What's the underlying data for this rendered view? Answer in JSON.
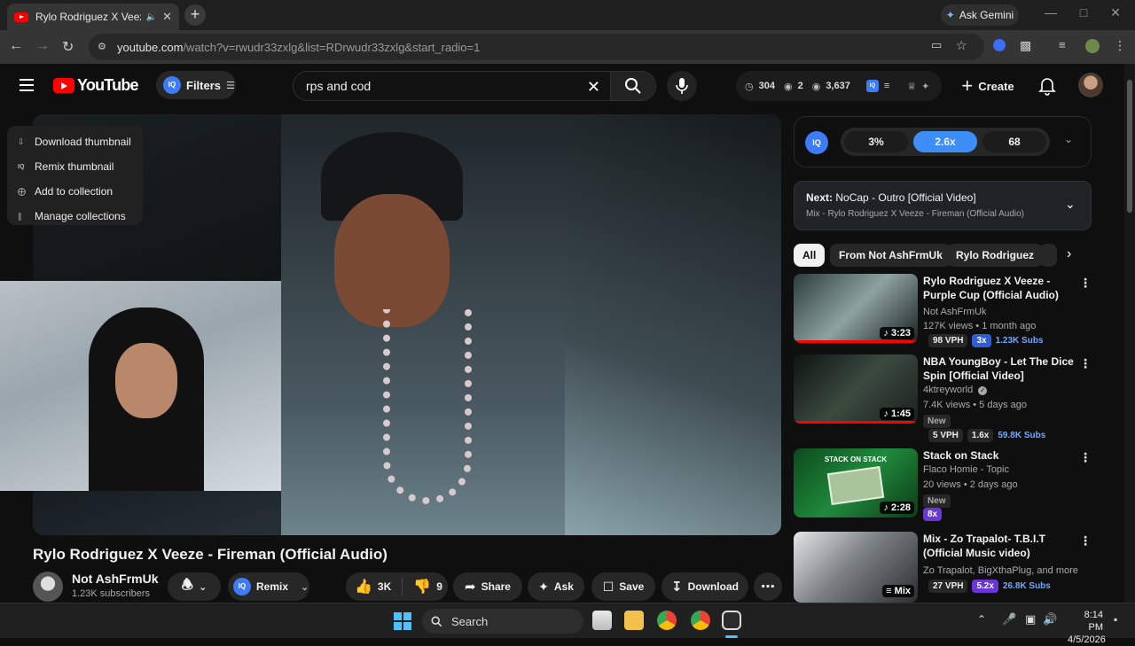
{
  "browser": {
    "tab_title": "Rylo Rodriguez X Veeze - Fi",
    "ask_gemini": "Ask Gemini",
    "url_host": "youtube.com",
    "url_path": "/watch?v=rwudr33zxlg&list=RDrwudr33zxlg&start_radio=1"
  },
  "header": {
    "logo_text": "YouTube",
    "filters_label": "Filters",
    "iq_badge": "IQ",
    "search_value": "rps and cod",
    "stats": {
      "clock_count": "304",
      "eye_count": "2",
      "views_count": "3,637"
    },
    "create_label": "Create"
  },
  "context_menu": {
    "items": [
      {
        "label": "Download thumbnail",
        "icon": "download-icon"
      },
      {
        "label": "Remix thumbnail",
        "icon": "iq-icon"
      },
      {
        "label": "Add to collection",
        "icon": "collection-add-icon"
      },
      {
        "label": "Manage collections",
        "icon": "library-icon"
      }
    ]
  },
  "video": {
    "title": "Rylo Rodriguez X Veeze - Fireman (Official Audio)",
    "channel_name": "Not AshFrmUk",
    "subscribers": "1.23K subscribers",
    "remix_label": "Remix",
    "likes": "3K",
    "dislikes": "9",
    "share_label": "Share",
    "ask_label": "Ask",
    "save_label": "Save",
    "download_label": "Download"
  },
  "iq_panel": {
    "seg1": "3%",
    "seg2": "2.6x",
    "seg3": "68"
  },
  "next_up": {
    "prefix": "Next:",
    "title": "NoCap - Outro [Official Video]",
    "mix": "Mix - Rylo Rodriguez X Veeze - Fireman (Official Audio)"
  },
  "chips": [
    "All",
    "From Not AshFrmUk",
    "Rylo Rodriguez"
  ],
  "recommendations": [
    {
      "title": "Rylo Rodriguez X Veeze - Purple Cup (Official Audio)",
      "channel": "Not AshFrmUk",
      "meta": "127K views • 1 month ago",
      "duration": "3:23",
      "vph": "98 VPH",
      "multiplier": "3x",
      "subs": "1.23K Subs",
      "new": ""
    },
    {
      "title": "NBA YoungBoy - Let The Dice Spin [Official Video]",
      "channel": "4ktreyworld",
      "meta": "7.4K views • 5 days ago",
      "duration": "1:45",
      "vph": "5 VPH",
      "multiplier": "1.6x",
      "subs": "59.8K Subs",
      "new": "New"
    },
    {
      "title": "Stack on Stack",
      "channel": "Flaco Homie - Topic",
      "meta": "20 views • 2 days ago",
      "duration": "2:28",
      "vph": "",
      "multiplier": "8x",
      "subs": "",
      "new": "New",
      "thumb_text": "STACK ON STACK"
    },
    {
      "title": "Mix - Zo Trapalot- T.B.I.T (Official Music video)",
      "channel": "Zo Trapalot, BigXthaPlug, and more",
      "meta": "",
      "duration": "Mix",
      "vph": "27 VPH",
      "multiplier": "5.2x",
      "subs": "26.8K Subs",
      "new": ""
    }
  ],
  "taskbar": {
    "search_label": "Search",
    "time": "8:14 PM",
    "date": "4/5/2026"
  }
}
